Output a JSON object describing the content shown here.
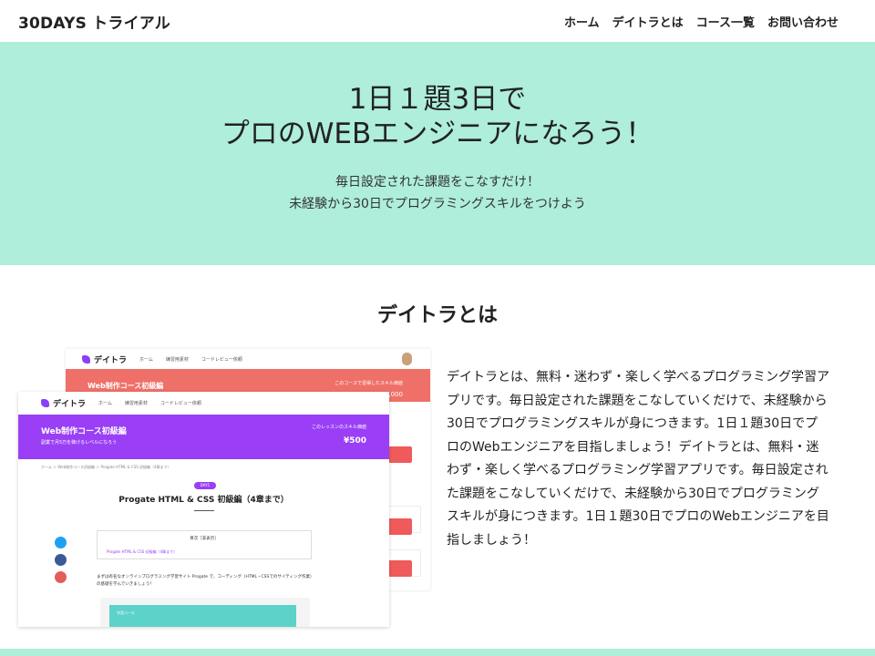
{
  "header": {
    "logo": "30DAYS トライアル",
    "nav": [
      "ホーム",
      "デイトラとは",
      "コース一覧",
      "お問い合わせ"
    ]
  },
  "hero": {
    "title_lines": [
      "1日１題3日で",
      "プロのWEBエンジニアになろう！"
    ],
    "subtitle_lines": [
      "毎日設定された課題をこなすだけ！",
      "未経験から30日でプログラミングスキルをつけよう"
    ]
  },
  "about": {
    "title": "デイトラとは",
    "text": "デイトラとは、無料・迷わず・楽しく学べるプログラミング学習アプリです。毎日設定された課題をこなしていくだけで、未経験から30日でプログラミングスキルが身につきます。1日１題30日でプロのWebエンジニアを目指しましょう！デイトラとは、無料・迷わず・楽しく学べるプログラミング学習アプリです。毎日設定された課題をこなしていくだけで、未経験から30日でプログラミングスキルが身につきます。1日１題30日でプロのWebエンジニアを目指しましょう！"
  },
  "screenshot": {
    "app_logo": "デイトラ",
    "nav": [
      "ホーム",
      "練習用素材",
      "コードレビュー依頼"
    ],
    "back_banner_title": "Web制作コース初級編",
    "back_banner_label": "このコースで習得したスキル価値",
    "back_banner_price": "¥400,000",
    "front_banner_title": "Web制作コース初級編",
    "front_banner_sub": "副業で月5万を稼げるレベルになろう",
    "front_banner_label": "このレッスンのスキル価値",
    "front_banner_price": "¥500",
    "breadcrumb": "ホーム ＞ Web制作コース初級編 ＞ Progate HTML & CSS 初級編（4章まで）",
    "day_badge": "DAY1",
    "lesson_title": "Progate HTML & CSS 初級編（4章まで）",
    "toc_head": "目次［非表示］",
    "toc_item": "Progate HTML & CSS 初級編（4章まで）",
    "body_text": "まずは有名なオンラインプログラミング学習サイト Progate で、コーディング（HTML・CSSでのサイティング作業）の基礎を学んでいきましょう！",
    "panel_label": "学習コース"
  },
  "colors": {
    "hero_bg": "#aeeedb",
    "purple": "#9a3ff5",
    "coral": "#ef7068",
    "twitter": "#1da1f2",
    "facebook": "#3b5998",
    "link": "#e35d5b"
  }
}
